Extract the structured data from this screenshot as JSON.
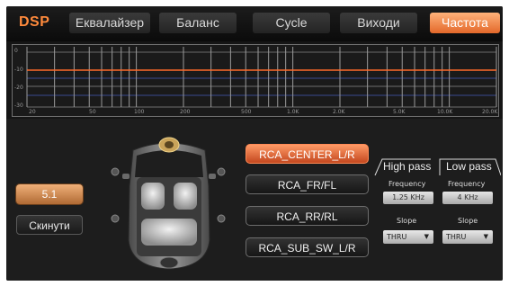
{
  "app": {
    "logo": "DSP"
  },
  "tabs": [
    {
      "label": "Еквалайзер",
      "active": false
    },
    {
      "label": "Баланс",
      "active": false
    },
    {
      "label": "Cycle",
      "active": false
    },
    {
      "label": "Виходи",
      "active": false
    },
    {
      "label": "Частота",
      "active": true
    }
  ],
  "graph": {
    "y_labels": [
      "0",
      "-10",
      "-20",
      "-30"
    ],
    "x_labels": [
      "20",
      "50",
      "100",
      "200",
      "500",
      "1.0K",
      "2.0K",
      "5.0K",
      "10.0K",
      "20.0K"
    ],
    "response_level_db": 0,
    "colors": {
      "response": "#ff6a2a",
      "grid": "#8a8a8a",
      "band": "#3a4a8a"
    }
  },
  "presets": {
    "preset_value": "5.1",
    "reset_label": "Скинути"
  },
  "channels": [
    {
      "label": "RCA_CENTER_L/R",
      "active": true
    },
    {
      "label": "RCA_FR/FL",
      "active": false
    },
    {
      "label": "RCA_RR/RL",
      "active": false
    },
    {
      "label": "RCA_SUB_SW_L/R",
      "active": false
    }
  ],
  "high_pass": {
    "title": "High pass",
    "frequency_label": "Frequency",
    "frequency_value": "1.25 KHz",
    "slope_label": "Slope",
    "slope_value": "THRU"
  },
  "low_pass": {
    "title": "Low pass",
    "frequency_label": "Frequency",
    "frequency_value": "4 KHz",
    "slope_label": "Slope",
    "slope_value": "THRU"
  },
  "colors": {
    "accent": "#ff8a3c",
    "active_button": "#e3682a"
  }
}
